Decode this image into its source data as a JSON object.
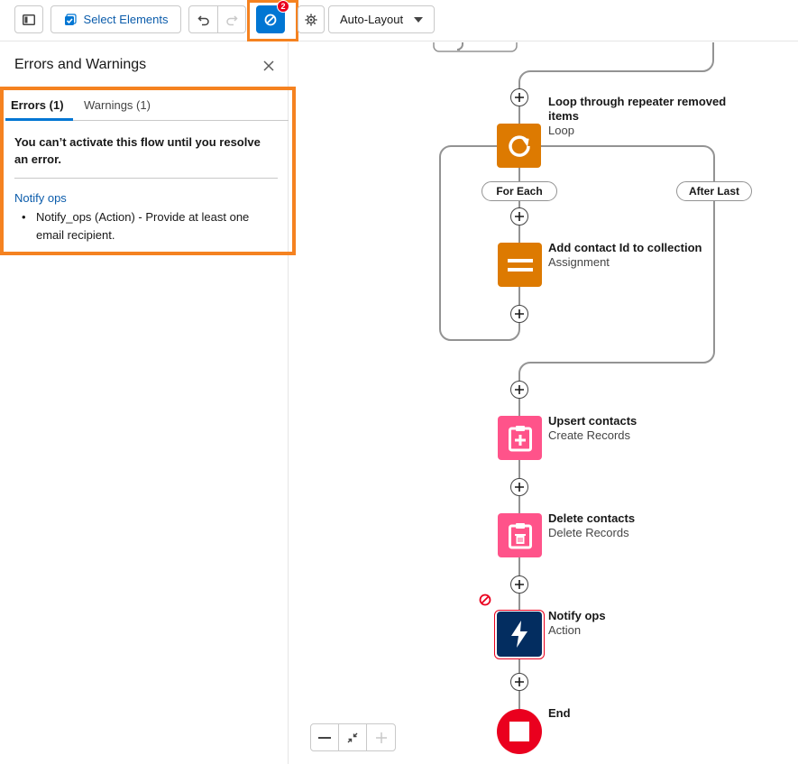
{
  "toolbar": {
    "select_elements_label": "Select Elements",
    "error_badge_count": "2",
    "layout_mode": "Auto-Layout"
  },
  "panel": {
    "title": "Errors and Warnings",
    "tabs": [
      {
        "label": "Errors (1)",
        "active": true
      },
      {
        "label": "Warnings (1)",
        "active": false
      }
    ],
    "error_message": "You can’t activate this flow until you resolve an error.",
    "error_link": "Notify ops",
    "error_detail": "Notify_ops (Action) - Provide at least one email recipient."
  },
  "flow": {
    "nodes": [
      {
        "title": "Loop through repeater removed items",
        "type": "Loop",
        "icon": "loop-icon",
        "color": "#dd7a01"
      },
      {
        "title": "Add contact Id to collection",
        "type": "Assignment",
        "icon": "assignment-icon",
        "color": "#dd7a01"
      },
      {
        "title": "Upsert contacts",
        "type": "Create Records",
        "icon": "create-records-icon",
        "color": "#ff538a"
      },
      {
        "title": "Delete contacts",
        "type": "Delete Records",
        "icon": "delete-records-icon",
        "color": "#ff538a"
      },
      {
        "title": "Notify ops",
        "type": "Action",
        "icon": "action-icon",
        "color": "#032d60"
      },
      {
        "title": "End",
        "type": "",
        "icon": "end-icon",
        "color": "#ea001e"
      }
    ],
    "for_each_label": "For Each",
    "after_last_label": "After Last"
  },
  "colors": {
    "accent": "#0176d3",
    "highlight": "#f58220",
    "error": "#ea001e"
  }
}
